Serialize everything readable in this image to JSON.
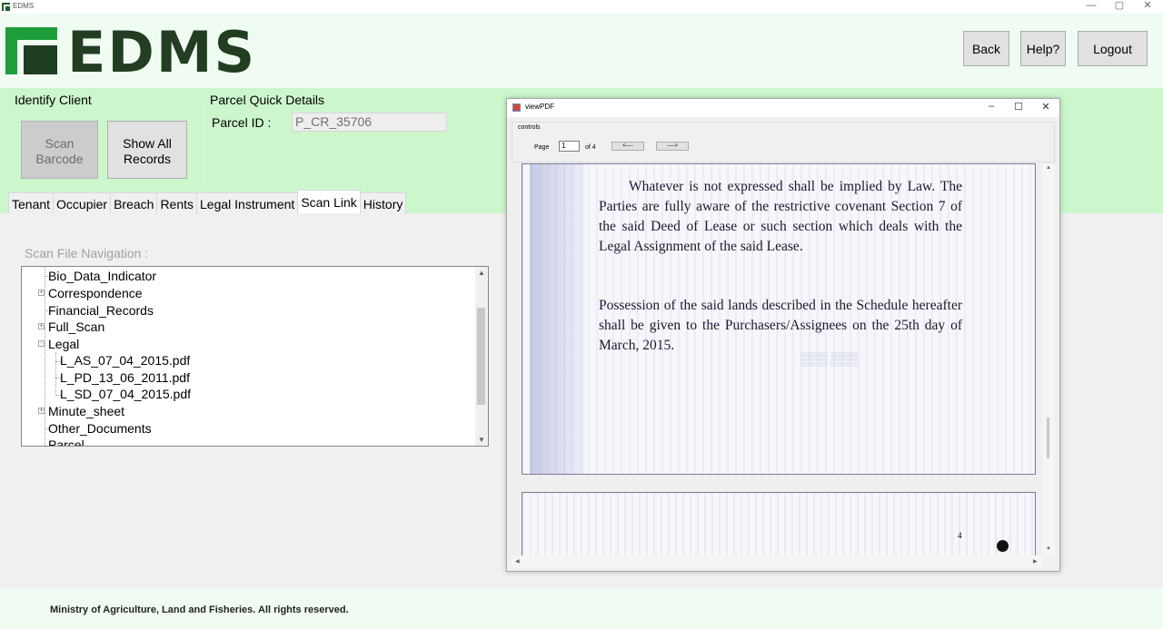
{
  "window": {
    "title": "EDMS",
    "controls": [
      "—",
      "▢",
      "✕"
    ]
  },
  "header": {
    "logo_text": "EDMS",
    "buttons": {
      "back": "Back",
      "help": "Help?",
      "logout": "Logout"
    }
  },
  "identify_client": {
    "label": "Identify Client",
    "scan_barcode": [
      "Scan",
      "Barcode"
    ],
    "show_all_records": [
      "Show All",
      "Records"
    ]
  },
  "parcel_quick": {
    "label": "Parcel Quick Details",
    "parcel_id_label": "Parcel ID :",
    "parcel_id_value": "P_CR_35706"
  },
  "tabs": [
    "Tenant",
    "Occupier",
    "Breach",
    "Rents",
    "Legal Instrument",
    "Scan Link",
    "History"
  ],
  "active_tab": "Scan Link",
  "scan_nav": {
    "label": "Scan File Navigation :",
    "items": [
      {
        "label": "Bio_Data_Indicator",
        "level": 0,
        "expander": false
      },
      {
        "label": "Correspondence",
        "level": 0,
        "expander": "+"
      },
      {
        "label": "Financial_Records",
        "level": 0,
        "expander": false
      },
      {
        "label": "Full_Scan",
        "level": 0,
        "expander": "+"
      },
      {
        "label": "Legal",
        "level": 0,
        "expander": "-"
      },
      {
        "label": "L_AS_07_04_2015.pdf",
        "level": 1,
        "expander": false
      },
      {
        "label": "L_PD_13_06_2011.pdf",
        "level": 1,
        "expander": false
      },
      {
        "label": "L_SD_07_04_2015.pdf",
        "level": 1,
        "expander": false
      },
      {
        "label": "Minute_sheet",
        "level": 0,
        "expander": "+"
      },
      {
        "label": "Other_Documents",
        "level": 0,
        "expander": false
      },
      {
        "label": "Parcel",
        "level": 0,
        "expander": false
      }
    ]
  },
  "pdf_viewer": {
    "title": "viewPDF",
    "controls_label": "controls",
    "page_label": "Page",
    "page_value": "1",
    "of_label": "of 4",
    "prev_label": "<----",
    "next_label": "---->",
    "paragraph1": "Whatever is not expressed shall be implied by Law. The Parties are fully aware of the restrictive covenant Section 7 of the said Deed of Lease or such section which deals with the Legal Assignment of the said Lease.",
    "paragraph2": "Possession of the said lands described in the Schedule hereafter shall be given to the Purchasers/Assignees on the 25th day of March, 2015.",
    "page2_number": "4"
  },
  "footer": {
    "text": "Ministry of Agriculture, Land and Fisheries. All rights reserved."
  },
  "colors": {
    "header_bg": "#f0fcf2",
    "band_bg": "#ccf7cc",
    "logo_green": "#1e9e3a",
    "logo_dark": "#223d22"
  }
}
